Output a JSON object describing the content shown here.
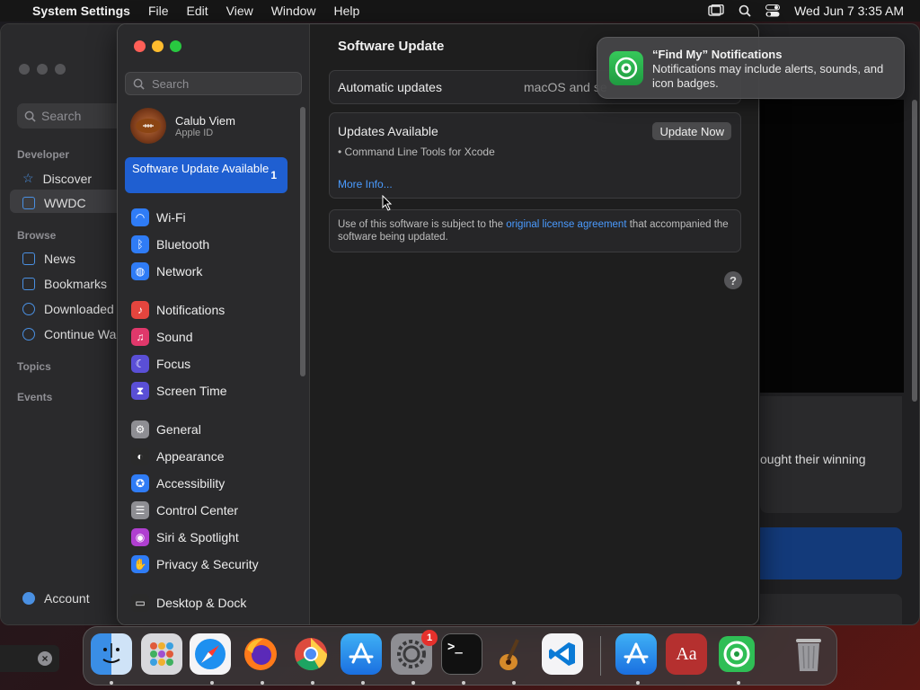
{
  "menubar": {
    "app_name": "System Settings",
    "items": [
      "File",
      "Edit",
      "View",
      "Window",
      "Help"
    ],
    "datetime": "Wed Jun 7  3:35 AM"
  },
  "bg_window": {
    "search_placeholder": "Search",
    "sections": [
      "Developer",
      "Browse",
      "Topics",
      "Events"
    ],
    "developer_items": [
      "Discover",
      "WWDC"
    ],
    "browse_items": [
      "News",
      "Bookmarks",
      "Downloaded",
      "Continue Wa"
    ],
    "account_label": "Account",
    "partial_text": "ought their winning"
  },
  "settings": {
    "search_placeholder": "Search",
    "account": {
      "name": "Calub Viem",
      "sub": "Apple ID"
    },
    "update_item": {
      "label": "Software Update Available",
      "count": "1"
    },
    "sidebar_items": [
      {
        "label": "Wi-Fi",
        "icon": "wifi-icon",
        "color": "#2f7cf6"
      },
      {
        "label": "Bluetooth",
        "icon": "bluetooth-icon",
        "color": "#2f7cf6"
      },
      {
        "label": "Network",
        "icon": "globe-icon",
        "color": "#2f7cf6"
      },
      {
        "label": "Notifications",
        "icon": "bell-icon",
        "color": "#e5453e"
      },
      {
        "label": "Sound",
        "icon": "speaker-icon",
        "color": "#e0386b"
      },
      {
        "label": "Focus",
        "icon": "moon-icon",
        "color": "#5a4fd6"
      },
      {
        "label": "Screen Time",
        "icon": "hourglass-icon",
        "color": "#5a4fd6"
      },
      {
        "label": "General",
        "icon": "gear-icon",
        "color": "#8e8e93"
      },
      {
        "label": "Appearance",
        "icon": "appearance-icon",
        "color": "#2a2a2a"
      },
      {
        "label": "Accessibility",
        "icon": "accessibility-icon",
        "color": "#2f7cf6"
      },
      {
        "label": "Control Center",
        "icon": "control-center-icon",
        "color": "#8e8e93"
      },
      {
        "label": "Siri & Spotlight",
        "icon": "siri-icon",
        "color": "#b03fd1"
      },
      {
        "label": "Privacy & Security",
        "icon": "hand-icon",
        "color": "#2f7cf6"
      },
      {
        "label": "Desktop & Dock",
        "icon": "dock-icon",
        "color": "#2a2a2a"
      }
    ]
  },
  "content": {
    "title": "Software Update",
    "automatic_label": "Automatic updates",
    "automatic_value": "macOS and se",
    "updates_title": "Updates Available",
    "update_now": "Update Now",
    "update_item": "• Command Line Tools for Xcode",
    "more_info": "More Info...",
    "license_pre": "Use of this software is subject to the ",
    "license_link": "original license agreement",
    "license_post": " that accompanied the software being updated.",
    "help": "?"
  },
  "notification": {
    "title": "“Find My” Notifications",
    "body": "Notifications may include alerts, sounds, and icon badges."
  },
  "dock": {
    "settings_badge": "1",
    "dictionary_glyph": "Aa",
    "terminal_glyph": ">_"
  }
}
